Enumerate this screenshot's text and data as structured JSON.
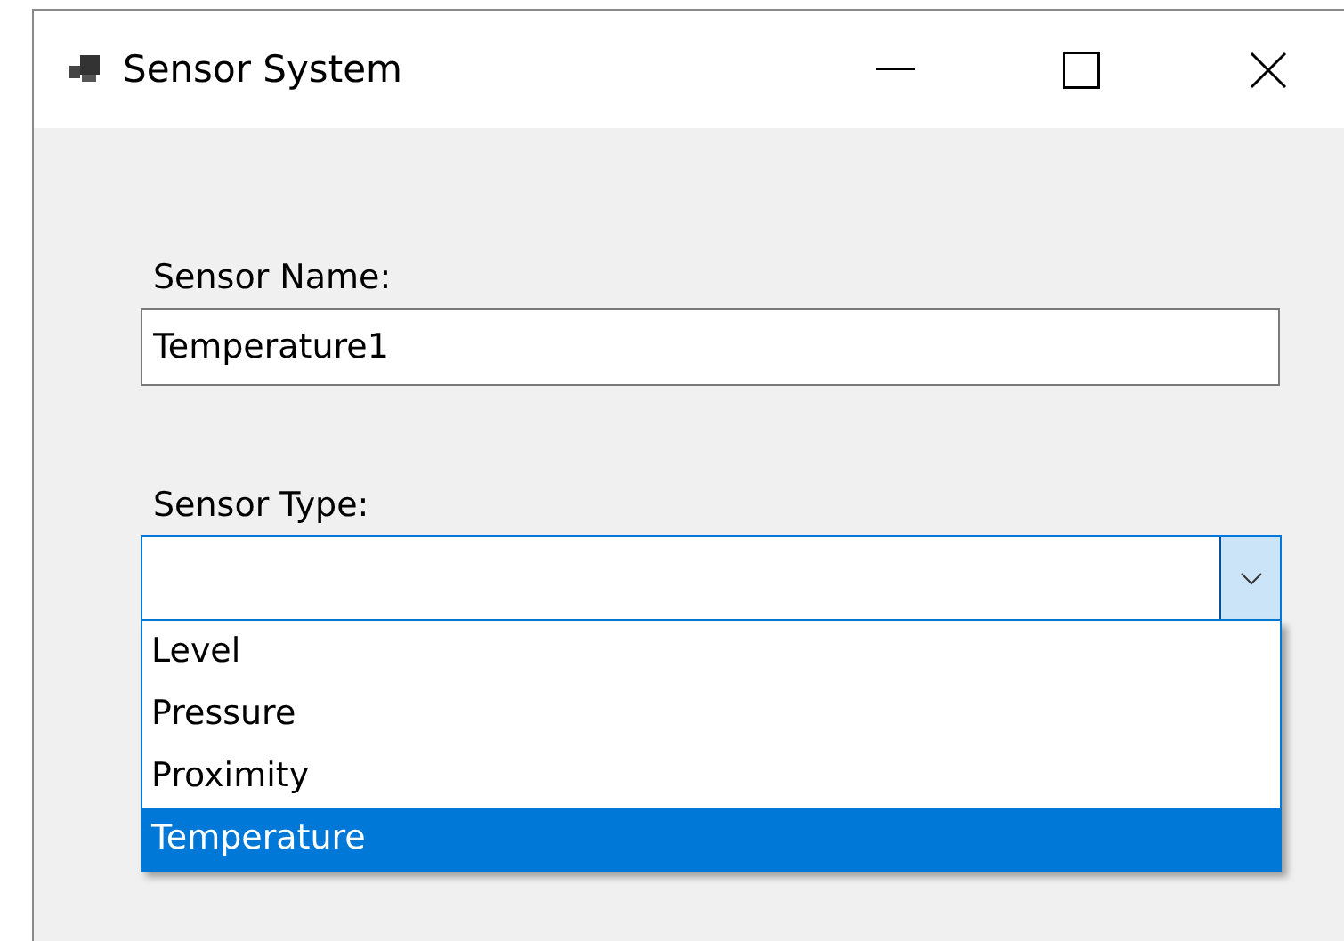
{
  "window": {
    "title": "Sensor System"
  },
  "sensor_name": {
    "label": "Sensor Name:",
    "value": "Temperature1"
  },
  "sensor_type": {
    "label": "Sensor Type:",
    "expanded": true,
    "options": [
      {
        "label": "Level",
        "selected": false
      },
      {
        "label": "Pressure",
        "selected": false
      },
      {
        "label": "Proximity",
        "selected": false
      },
      {
        "label": "Temperature",
        "selected": true
      }
    ]
  }
}
